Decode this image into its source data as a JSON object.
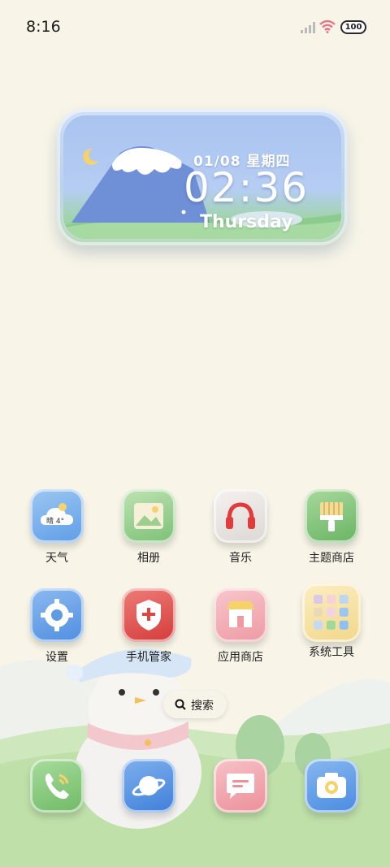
{
  "status_bar": {
    "time": "8:16",
    "battery": "100"
  },
  "widget": {
    "date": "01/08 星期四",
    "time": "02:36",
    "day": "Thursday"
  },
  "apps_row1": [
    {
      "label": "天气",
      "icon": "weather-icon",
      "weather_text": "晴 4°"
    },
    {
      "label": "相册",
      "icon": "gallery-icon"
    },
    {
      "label": "音乐",
      "icon": "headphones-icon"
    },
    {
      "label": "主题商店",
      "icon": "theme-brush-icon"
    }
  ],
  "apps_row2": [
    {
      "label": "设置",
      "icon": "gear-icon"
    },
    {
      "label": "手机管家",
      "icon": "shield-icon"
    },
    {
      "label": "应用商店",
      "icon": "store-icon"
    },
    {
      "label": "系统工具",
      "icon": "folder-icon"
    }
  ],
  "search": {
    "label": "搜索"
  },
  "dock": [
    {
      "icon": "phone-icon"
    },
    {
      "icon": "browser-planet-icon"
    },
    {
      "icon": "message-icon"
    },
    {
      "icon": "camera-icon"
    }
  ]
}
